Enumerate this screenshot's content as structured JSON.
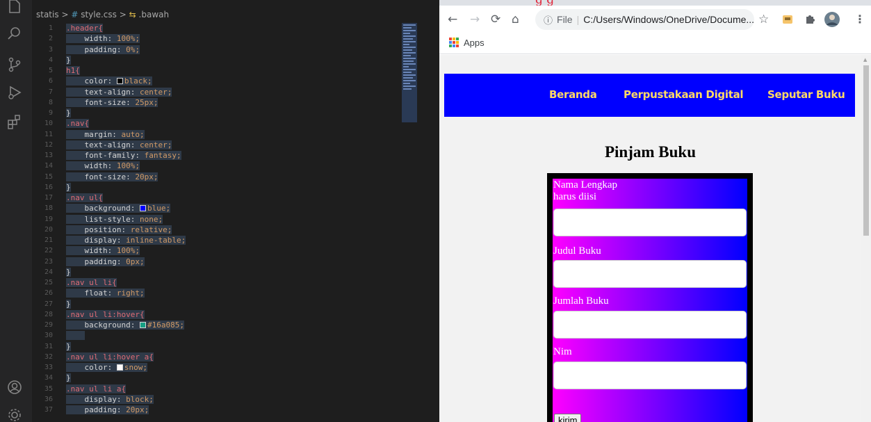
{
  "editor": {
    "breadcrumb": {
      "folder": "statis",
      "sep": ">",
      "file_icon": "#",
      "file": "style.css",
      "symbol": ".bawah"
    },
    "activity_icons": [
      "files-icon",
      "search-icon",
      "source-control-icon",
      "run-debug-icon",
      "extensions-icon",
      "account-icon",
      "settings-gear-icon"
    ],
    "line_numbers": [
      "1",
      "2",
      "3",
      "4",
      "5",
      "6",
      "7",
      "8",
      "9",
      "10",
      "11",
      "12",
      "13",
      "14",
      "15",
      "16",
      "17",
      "18",
      "19",
      "20",
      "21",
      "22",
      "23",
      "24",
      "25",
      "26",
      "27",
      "28",
      "29",
      "30",
      "31",
      "32",
      "33",
      "34",
      "35",
      "36",
      "37"
    ],
    "lines": [
      {
        "s": ".header{"
      },
      {
        "p": "width",
        "v": "100%;"
      },
      {
        "p": "padding",
        "v": "0%;"
      },
      {
        "b": "}"
      },
      {
        "s": "h1{"
      },
      {
        "p": "color",
        "v": "black;",
        "swatch": "#000000"
      },
      {
        "p": "text-align",
        "v": "center;"
      },
      {
        "p": "font-size",
        "v": "25px;"
      },
      {
        "b": "}"
      },
      {
        "s": ".nav{"
      },
      {
        "p": "margin",
        "v": "auto;"
      },
      {
        "p": "text-align",
        "v": "center;"
      },
      {
        "p": "font-family",
        "v": "fantasy;"
      },
      {
        "p": "width",
        "v": "100%;"
      },
      {
        "p": "font-size",
        "v": "20px;"
      },
      {
        "b": "}"
      },
      {
        "s": ".nav ul{"
      },
      {
        "p": "background",
        "v": "blue;",
        "swatch": "#0000ff"
      },
      {
        "p": "list-style",
        "v": "none;"
      },
      {
        "p": "position",
        "v": "relative;"
      },
      {
        "p": "display",
        "v": "inline-table;"
      },
      {
        "p": "width",
        "v": "100%;"
      },
      {
        "p": "padding",
        "v": "0px;"
      },
      {
        "b": "}"
      },
      {
        "s": ".nav ul li{"
      },
      {
        "p": "float",
        "v": "right;"
      },
      {
        "b": "}"
      },
      {
        "s": ".nav ul li:hover{"
      },
      {
        "p": "background",
        "v": "#16a085;",
        "swatch": "#16a085"
      },
      {
        "b": ""
      },
      {
        "b": "}"
      },
      {
        "s": ".nav ul li:hover a{"
      },
      {
        "p": "color",
        "v": "snow;",
        "swatch": "#fffafa"
      },
      {
        "b": "}"
      },
      {
        "s": ".nav ul li a{"
      },
      {
        "p": "display",
        "v": "block;"
      },
      {
        "p": "padding",
        "v": "20px;"
      }
    ]
  },
  "browser": {
    "tab_title_fragment": "g   g",
    "address": {
      "scheme_label": "File",
      "url": "C:/Users/Windows/OneDrive/Docume..."
    },
    "bookmarks": {
      "apps_label": "Apps"
    },
    "page": {
      "nav_links": [
        "Beranda",
        "Perpustakaan Digital",
        "Seputar Buku"
      ],
      "title": "Pinjam Buku",
      "form": {
        "fields": [
          {
            "label": "Nama Lengkap",
            "hint": "harus diisi",
            "value": ""
          },
          {
            "label": "Judul Buku",
            "value": ""
          },
          {
            "label": "Jumlah Buku",
            "value": ""
          },
          {
            "label": "Nim",
            "value": ""
          }
        ],
        "submit_label": "kirim"
      }
    }
  },
  "colors": {
    "nav_bg": "#0000ff",
    "nav_link": "#ffd966",
    "gradient_from": "#ff00ff",
    "gradient_to": "#0000ff"
  }
}
